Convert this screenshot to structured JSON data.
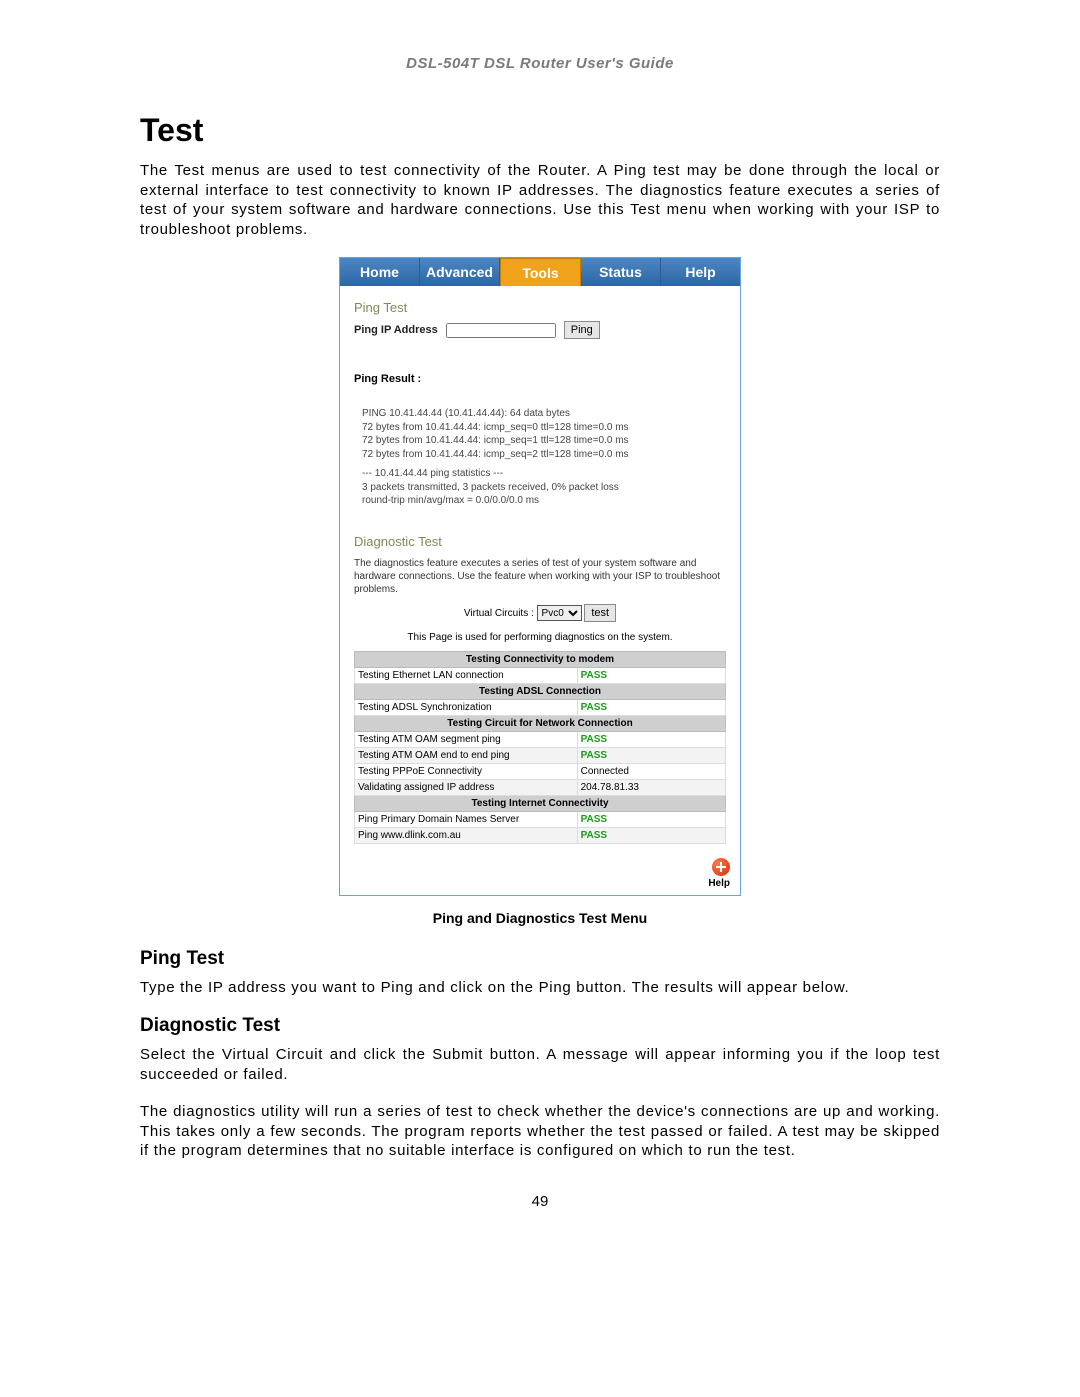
{
  "doc_header": "DSL-504T DSL Router User's Guide",
  "h_test": "Test",
  "intro_text": "The Test menus are used to test connectivity of the Router. A Ping test may be done through the local or external interface to test connectivity to known IP addresses. The diagnostics feature executes a series of test of your system software and hardware connections. Use this Test menu when working with your ISP to troubleshoot problems.",
  "tabs": {
    "home": "Home",
    "advanced": "Advanced",
    "tools": "Tools",
    "status": "Status",
    "help": "Help"
  },
  "ping_section": {
    "title": "Ping Test",
    "ip_label": "Ping IP Address",
    "ip_value": "",
    "ping_btn": "Ping",
    "result_label": "Ping Result :",
    "lines": [
      "PING 10.41.44.44 (10.41.44.44): 64 data bytes",
      "72 bytes from 10.41.44.44: icmp_seq=0 ttl=128 time=0.0 ms",
      "72 bytes from 10.41.44.44: icmp_seq=1 ttl=128 time=0.0 ms",
      "72 bytes from 10.41.44.44: icmp_seq=2 ttl=128 time=0.0 ms",
      "--- 10.41.44.44 ping statistics ---",
      "3 packets transmitted, 3 packets received, 0% packet loss",
      "round-trip min/avg/max = 0.0/0.0/0.0 ms"
    ]
  },
  "diag_section": {
    "title": "Diagnostic Test",
    "desc": "The diagnostics feature executes a series of test of your system software and hardware connections. Use the feature when working with your ISP to troubleshoot problems.",
    "vc_label": "Virtual Circuits :",
    "vc_value": "Pvc0",
    "test_btn": "test",
    "note": "This Page is used for performing diagnostics on the system.",
    "groups": [
      {
        "header": "Testing Connectivity to modem",
        "rows": [
          {
            "name": "Testing Ethernet LAN connection",
            "result": "PASS",
            "pass": true
          }
        ]
      },
      {
        "header": "Testing ADSL Connection",
        "rows": [
          {
            "name": "Testing ADSL Synchronization",
            "result": "PASS",
            "pass": true
          }
        ]
      },
      {
        "header": "Testing Circuit for Network Connection",
        "rows": [
          {
            "name": "Testing ATM OAM segment ping",
            "result": "PASS",
            "pass": true
          },
          {
            "name": "Testing ATM OAM end to end ping",
            "result": "PASS",
            "pass": true
          },
          {
            "name": "Testing PPPoE Connectivity",
            "result": "Connected",
            "pass": false
          },
          {
            "name": "Validating assigned IP address",
            "result": "204.78.81.33",
            "pass": false
          }
        ]
      },
      {
        "header": "Testing Internet Connectivity",
        "rows": [
          {
            "name": "Ping Primary Domain Names Server",
            "result": "PASS",
            "pass": true
          },
          {
            "name": "Ping www.dlink.com.au",
            "result": "PASS",
            "pass": true
          }
        ]
      }
    ],
    "help_label": "Help"
  },
  "caption": "Ping and Diagnostics Test Menu",
  "ping_heading": "Ping Test",
  "ping_body": "Type the IP address you want to Ping and click on the Ping button. The results will appear below.",
  "diag_heading": "Diagnostic Test",
  "diag_body1": "Select the Virtual Circuit and click the Submit button. A message will appear informing you if the loop test succeeded or failed.",
  "diag_body2": "The diagnostics utility will run a series of test to check whether the device's connections are up and working. This takes only a few seconds. The program reports whether the test passed or failed. A test may be skipped if the program determines that no suitable interface is configured on which to run the test.",
  "page_number": "49"
}
